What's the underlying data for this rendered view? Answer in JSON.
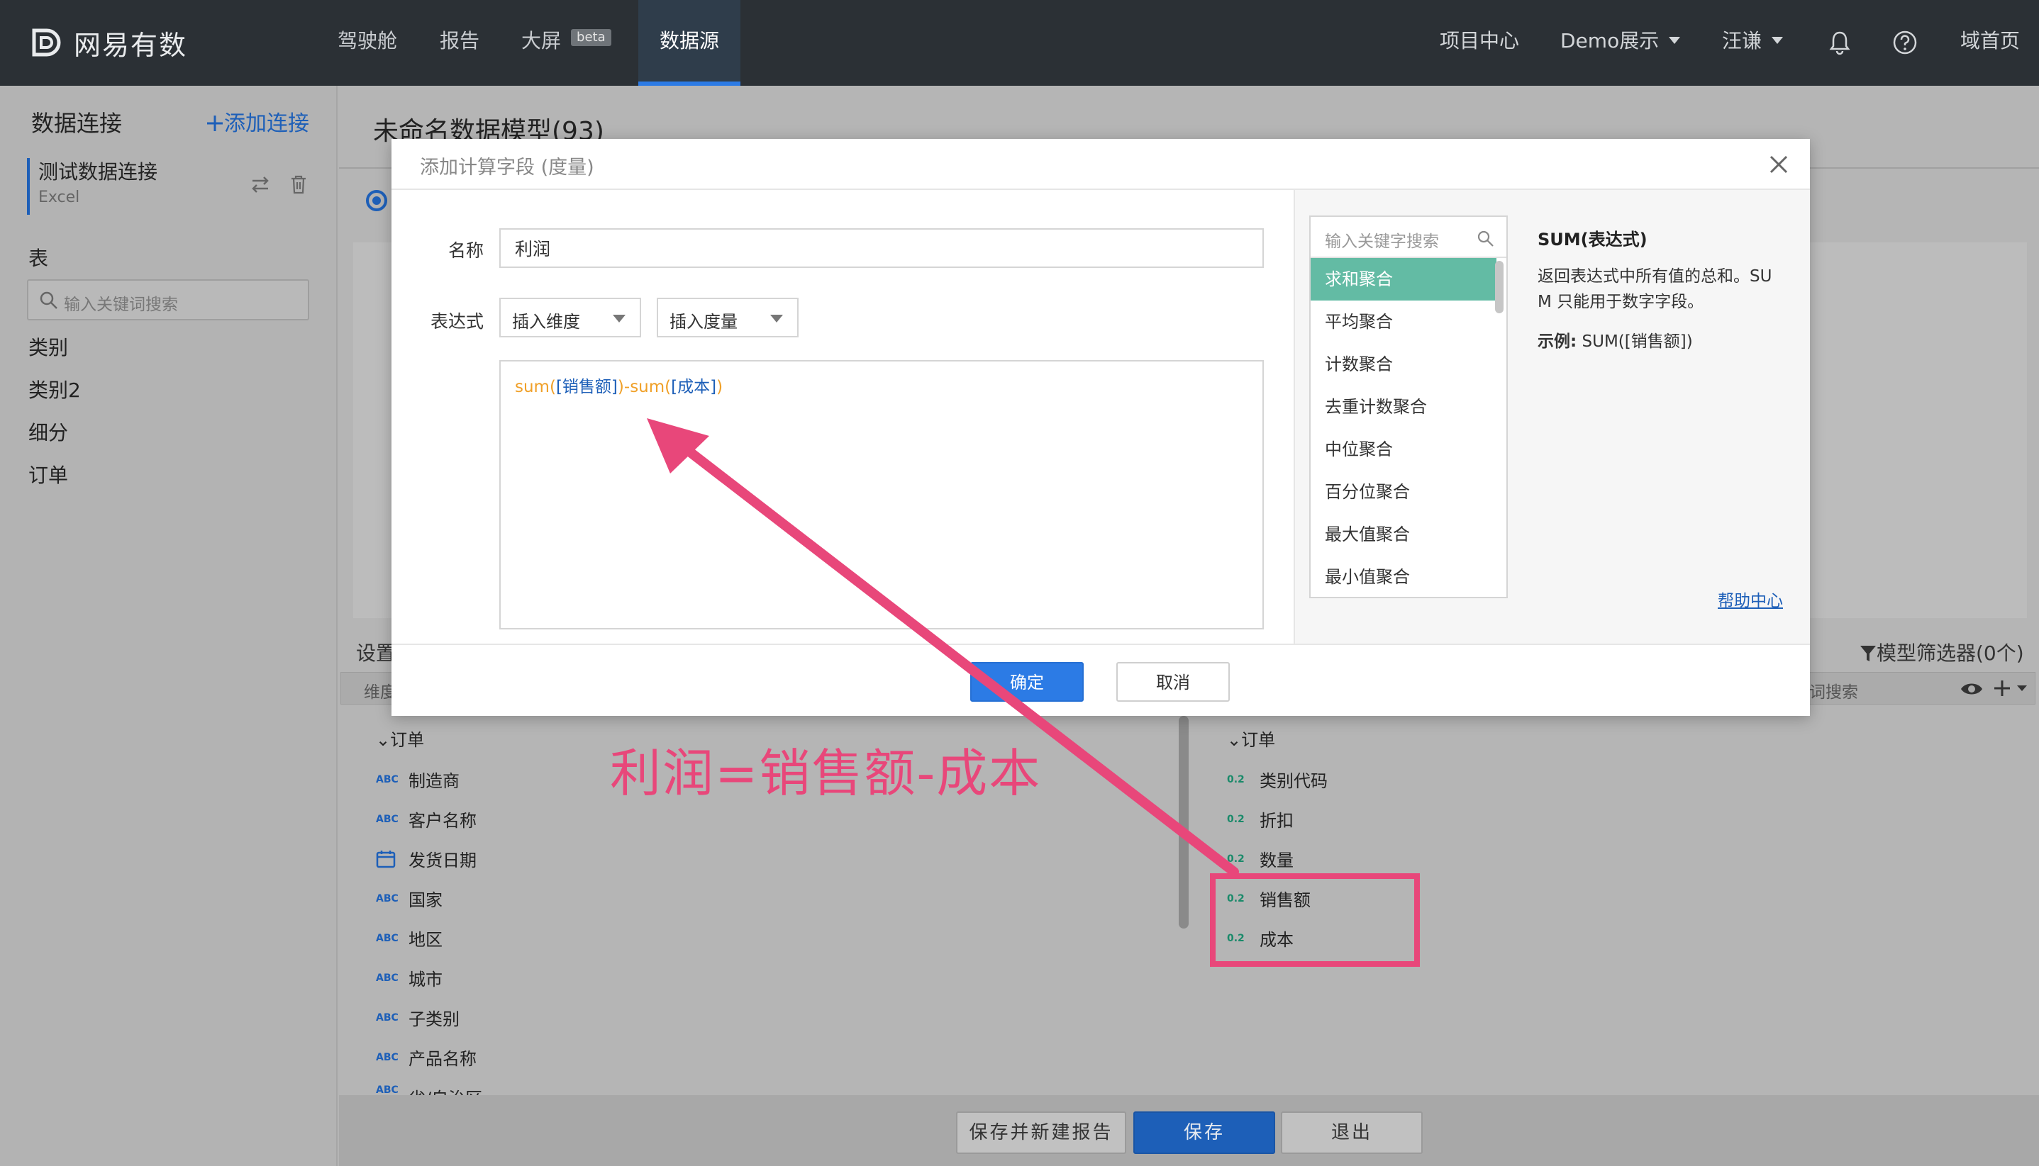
{
  "topbar": {
    "brand": "网易有数",
    "nav": [
      {
        "label": "驾驶舱"
      },
      {
        "label": "报告"
      },
      {
        "label": "大屏",
        "badge": "beta"
      },
      {
        "label": "数据源",
        "active": true
      }
    ],
    "right": {
      "project_center": "项目中心",
      "project_menu": "Demo展示",
      "user_menu": "汪谦",
      "domain_home": "域首页"
    }
  },
  "sidebar": {
    "title": "数据连接",
    "add_connection": "添加连接",
    "connection": {
      "name": "测试数据连接",
      "type": "Excel"
    },
    "tables_label": "表",
    "search_placeholder": "输入关键词搜索",
    "tables": [
      "类别",
      "类别2",
      "细分",
      "订单"
    ]
  },
  "main": {
    "title": "未命名数据模型(93)",
    "settings_label": "设置",
    "filter_label": "模型筛选器(0个)",
    "dimension_header": "维度",
    "measure_search_fragment": "词搜索",
    "dimensions": {
      "group": "订单",
      "items": [
        {
          "tag": "ABC",
          "name": "制造商"
        },
        {
          "tag": "ABC",
          "name": "客户名称"
        },
        {
          "tag": "date",
          "name": "发货日期"
        },
        {
          "tag": "ABC",
          "name": "国家"
        },
        {
          "tag": "ABC",
          "name": "地区"
        },
        {
          "tag": "ABC",
          "name": "城市"
        },
        {
          "tag": "ABC",
          "name": "子类别"
        },
        {
          "tag": "ABC",
          "name": "产品名称"
        },
        {
          "tag": "ABC",
          "name": "省/自治区"
        }
      ]
    },
    "measures": {
      "group": "订单",
      "items": [
        {
          "tag": "0.2",
          "name": "类别代码"
        },
        {
          "tag": "0.2",
          "name": "折扣"
        },
        {
          "tag": "0.2",
          "name": "数量"
        },
        {
          "tag": "0.2",
          "name": "销售额"
        },
        {
          "tag": "0.2",
          "name": "成本"
        }
      ]
    },
    "footer_buttons": {
      "save_and_new": "保存并新建报告",
      "save": "保存",
      "exit": "退出"
    }
  },
  "modal": {
    "title": "添加计算字段 (度量)",
    "name_label": "名称",
    "name_value": "利润",
    "expression_label": "表达式",
    "insert_dimension": "插入维度",
    "insert_measure": "插入度量",
    "expression": {
      "fn1": "sum",
      "open1": "(",
      "field1": "[销售额]",
      "close1": ")",
      "minus": "-",
      "fn2": "sum",
      "open2": "(",
      "field2": "[成本]",
      "close2": ")"
    },
    "function_search_placeholder": "输入关键字搜索",
    "functions": [
      "求和聚合",
      "平均聚合",
      "计数聚合",
      "去重计数聚合",
      "中位聚合",
      "百分位聚合",
      "最大值聚合",
      "最小值聚合"
    ],
    "doc": {
      "title": "SUM(表达式)",
      "description": "返回表达式中所有值的总和。SUM 只能用于数字字段。",
      "example_label": "示例:",
      "example_value": " SUM([销售额])"
    },
    "help_link": "帮助中心",
    "ok_label": "确定",
    "cancel_label": "取消"
  },
  "annotation": {
    "text": "利润=销售额-成本",
    "color": "#e8477a"
  },
  "colors": {
    "topbar_bg": "#2b3035",
    "accent_blue": "#2c7be5",
    "list_active": "#63bba4",
    "function_orange": "#f0a028"
  }
}
